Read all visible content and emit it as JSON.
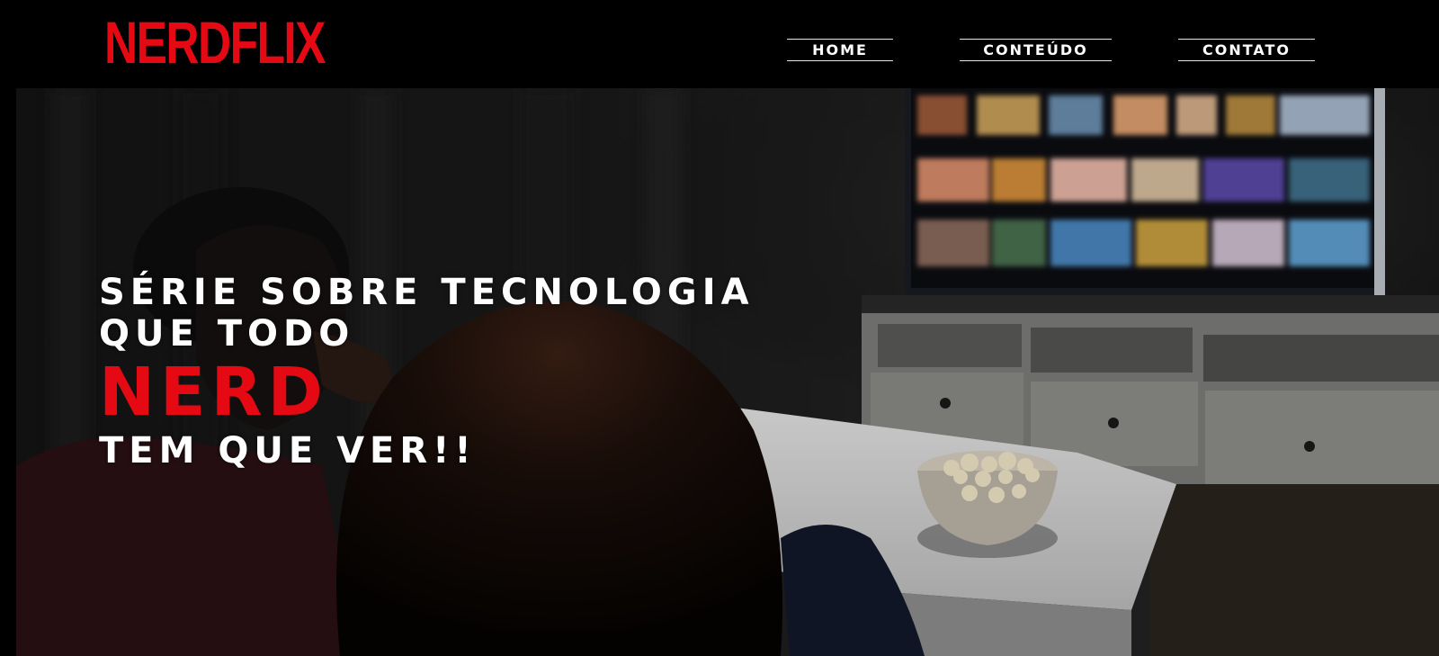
{
  "brand": {
    "logo_text": "NERDFLIX",
    "accent_color": "#e50914"
  },
  "nav": {
    "home": "HOME",
    "conteudo": "CONTEÚDO",
    "contato": "CONTATO"
  },
  "hero": {
    "line1": "SÉRIE SOBRE TECNOLOGIA",
    "line2": "QUE TODO",
    "line3": "NERD",
    "line4": "TEM QUE VER!!",
    "background_image": "people-watching-tv-with-popcorn-photo"
  }
}
